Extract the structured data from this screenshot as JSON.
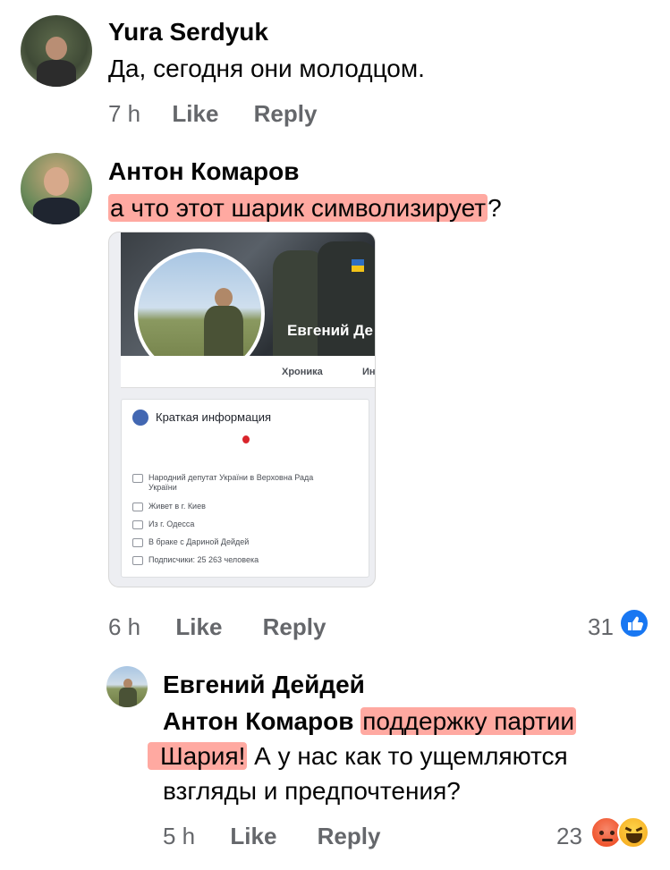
{
  "comments": [
    {
      "author": "Yura Serdyuk",
      "text": "Да, сегодня они молодцом.",
      "time": "7 h",
      "like_label": "Like",
      "reply_label": "Reply"
    },
    {
      "author": "Антон Комаров",
      "text_highlighted": "а что этот шарик символизирует",
      "text_tail": "?",
      "time": "6 h",
      "like_label": "Like",
      "reply_label": "Reply",
      "reaction_count": "31",
      "reaction_icons": [
        "like-icon"
      ],
      "attachment": {
        "cover_name": "Евгений Де",
        "tabs": [
          "Хроника",
          "Ин"
        ],
        "info_title": "Краткая информация",
        "rows": [
          {
            "text": "Народний депутат України в Верховна Рада",
            "sub": "України"
          },
          {
            "text": "Живет в г. Киев"
          },
          {
            "text": "Из г. Одесса"
          },
          {
            "text": "В браке с Дариной Дейдей"
          },
          {
            "text": "Подписчики: 25 263 человека"
          }
        ]
      }
    },
    {
      "author": "Евгений Дейдей",
      "mention": "Антон Комаров",
      "line1_highlight": "поддержку партии",
      "line2_highlight": "Шария!",
      "line2_rest": " А у нас как то ущемляются",
      "line3": "взгляды и предпочтения?",
      "time": "5 h",
      "like_label": "Like",
      "reply_label": "Reply",
      "reaction_count": "23",
      "reaction_icons": [
        "angry-icon",
        "haha-icon"
      ]
    }
  ],
  "colors": {
    "highlight": "#ff6354",
    "meta": "#65676b",
    "like_blue": "#1877f2",
    "angry": "#f0562f",
    "haha": "#f7b125"
  }
}
